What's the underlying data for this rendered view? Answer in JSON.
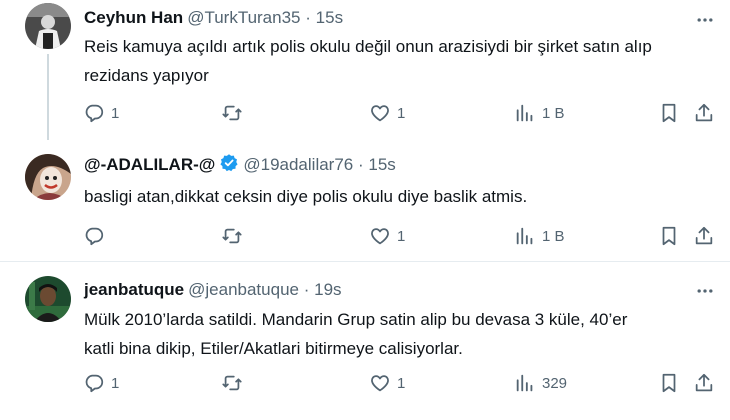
{
  "tweets": [
    {
      "name": "Ceyhun Han",
      "handle": "@TurkTuran35",
      "separator": "·",
      "time": "15s",
      "text_lines": [
        "Reis kamuya açıldı artık polis okulu değil onun arazisiydi bir şirket satın alıp",
        "rezidans yapıyor"
      ],
      "replies": "1",
      "retweets": "",
      "likes": "1",
      "views": "1 B",
      "verified": false
    },
    {
      "name": "@-ADALILAR-@",
      "handle": "@19adalilar76",
      "separator": "·",
      "time": "15s",
      "text_lines": [
        "basligi atan,dikkat ceksin diye polis okulu diye baslik atmis."
      ],
      "replies": "",
      "retweets": "",
      "likes": "1",
      "views": "1 B",
      "verified": true
    },
    {
      "name": "jeanbatuque",
      "handle": "@jeanbatuque",
      "separator": "·",
      "time": "19s",
      "text_lines": [
        "Mülk 2010’larda satildi. Mandarin Grup satin alip bu devasa 3 küle, 40’er",
        "katli bina dikip, Etiler/Akatlari bitirmeye calisiyorlar."
      ],
      "replies": "1",
      "retweets": "",
      "likes": "1",
      "views": "329",
      "verified": false
    }
  ],
  "colors": {
    "text": "#0f1419",
    "secondary": "#536471",
    "verified_blue": "#1d9bf0",
    "thread_line": "#cfd9de"
  },
  "icons": [
    "reply-icon",
    "retweet-icon",
    "like-icon",
    "views-icon",
    "bookmark-icon",
    "share-icon",
    "more-icon",
    "verified-badge-icon"
  ]
}
